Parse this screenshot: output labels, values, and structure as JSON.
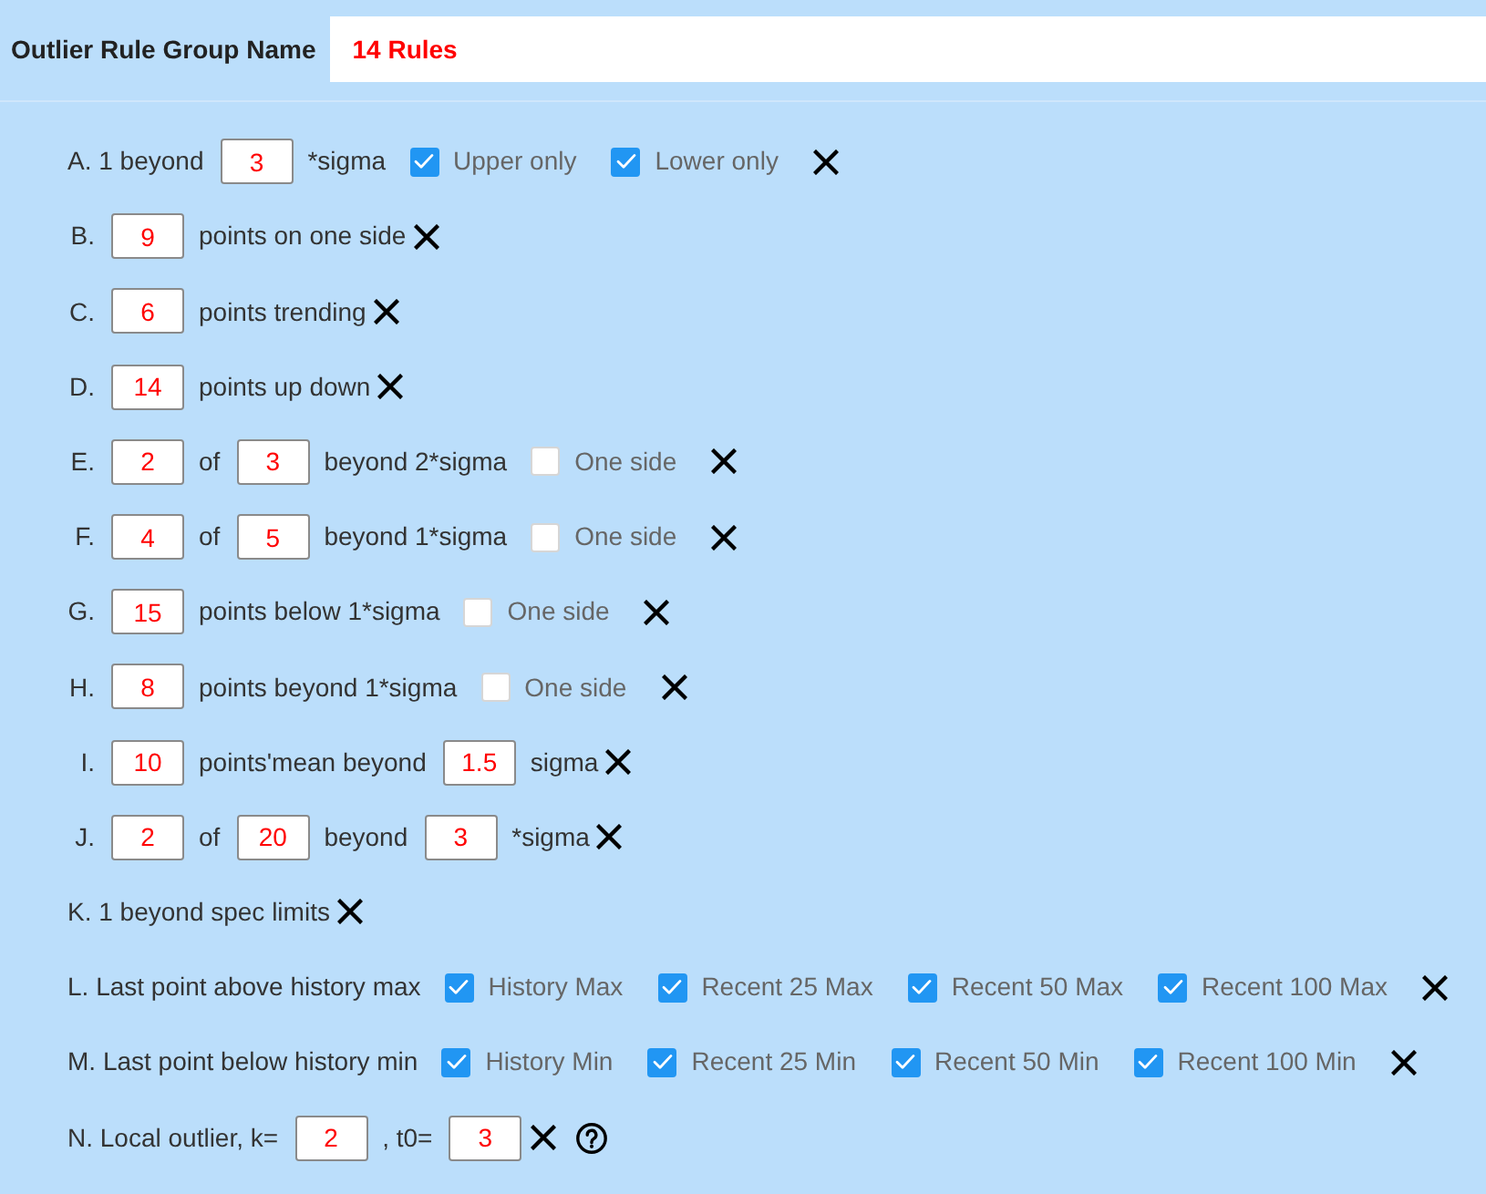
{
  "header": {
    "label": "Outlier Rule Group Name",
    "value": "14 Rules"
  },
  "rules": [
    {
      "help": false,
      "parts": [
        {
          "kind": "text",
          "text": "A. 1 beyond"
        },
        {
          "kind": "input",
          "value": "3"
        },
        {
          "kind": "text",
          "text": "*sigma"
        },
        {
          "kind": "checkbox",
          "label": "Upper only",
          "checked": true
        },
        {
          "kind": "checkbox",
          "label": "Lower only",
          "checked": true
        }
      ]
    },
    {
      "help": false,
      "parts": [
        {
          "kind": "letter",
          "text": "B."
        },
        {
          "kind": "input",
          "value": "9"
        },
        {
          "kind": "text",
          "text": "points on one side"
        }
      ]
    },
    {
      "help": false,
      "parts": [
        {
          "kind": "letter",
          "text": "C."
        },
        {
          "kind": "input",
          "value": "6"
        },
        {
          "kind": "text",
          "text": "points trending"
        }
      ]
    },
    {
      "help": false,
      "parts": [
        {
          "kind": "letter",
          "text": "D."
        },
        {
          "kind": "input",
          "value": "14"
        },
        {
          "kind": "text",
          "text": "points up down"
        }
      ]
    },
    {
      "help": false,
      "parts": [
        {
          "kind": "letter",
          "text": "E."
        },
        {
          "kind": "input",
          "value": "2"
        },
        {
          "kind": "text",
          "text": "of"
        },
        {
          "kind": "input",
          "value": "3"
        },
        {
          "kind": "text",
          "text": "beyond 2*sigma"
        },
        {
          "kind": "checkbox",
          "label": "One side",
          "checked": false
        }
      ]
    },
    {
      "help": false,
      "parts": [
        {
          "kind": "letter",
          "text": "F."
        },
        {
          "kind": "input",
          "value": "4"
        },
        {
          "kind": "text",
          "text": "of"
        },
        {
          "kind": "input",
          "value": "5"
        },
        {
          "kind": "text",
          "text": "beyond 1*sigma"
        },
        {
          "kind": "checkbox",
          "label": "One side",
          "checked": false
        }
      ]
    },
    {
      "help": false,
      "parts": [
        {
          "kind": "letter",
          "text": "G."
        },
        {
          "kind": "input",
          "value": "15"
        },
        {
          "kind": "text",
          "text": "points below 1*sigma"
        },
        {
          "kind": "checkbox",
          "label": "One side",
          "checked": false
        }
      ]
    },
    {
      "help": false,
      "parts": [
        {
          "kind": "letter",
          "text": "H."
        },
        {
          "kind": "input",
          "value": "8"
        },
        {
          "kind": "text",
          "text": "points beyond 1*sigma"
        },
        {
          "kind": "checkbox",
          "label": "One side",
          "checked": false
        }
      ]
    },
    {
      "help": false,
      "parts": [
        {
          "kind": "letter",
          "text": "I."
        },
        {
          "kind": "input",
          "value": "10"
        },
        {
          "kind": "text",
          "text": "points'mean beyond"
        },
        {
          "kind": "input",
          "value": "1.5"
        },
        {
          "kind": "text",
          "text": "sigma"
        }
      ]
    },
    {
      "help": false,
      "parts": [
        {
          "kind": "letter",
          "text": "J."
        },
        {
          "kind": "input",
          "value": "2"
        },
        {
          "kind": "text",
          "text": "of"
        },
        {
          "kind": "input",
          "value": "20"
        },
        {
          "kind": "text",
          "text": "beyond"
        },
        {
          "kind": "input",
          "value": "3"
        },
        {
          "kind": "text",
          "text": "*sigma"
        }
      ]
    },
    {
      "help": false,
      "parts": [
        {
          "kind": "text",
          "text": "K. 1 beyond spec limits"
        }
      ]
    },
    {
      "help": false,
      "parts": [
        {
          "kind": "text",
          "text": "L. Last point above history max"
        },
        {
          "kind": "checkbox",
          "label": "History Max",
          "checked": true
        },
        {
          "kind": "checkbox",
          "label": "Recent 25 Max",
          "checked": true
        },
        {
          "kind": "checkbox",
          "label": "Recent 50 Max",
          "checked": true
        },
        {
          "kind": "checkbox",
          "label": "Recent 100 Max",
          "checked": true
        }
      ]
    },
    {
      "help": false,
      "parts": [
        {
          "kind": "text",
          "text": "M. Last point below history min"
        },
        {
          "kind": "checkbox",
          "label": "History Min",
          "checked": true
        },
        {
          "kind": "checkbox",
          "label": "Recent 25 Min",
          "checked": true
        },
        {
          "kind": "checkbox",
          "label": "Recent 50 Min",
          "checked": true
        },
        {
          "kind": "checkbox",
          "label": "Recent 100 Min",
          "checked": true
        }
      ]
    },
    {
      "help": true,
      "parts": [
        {
          "kind": "text",
          "text": "N. Local outlier, k="
        },
        {
          "kind": "input",
          "value": "2"
        },
        {
          "kind": "text",
          "text": ", t0="
        },
        {
          "kind": "input",
          "value": "3"
        }
      ]
    }
  ]
}
